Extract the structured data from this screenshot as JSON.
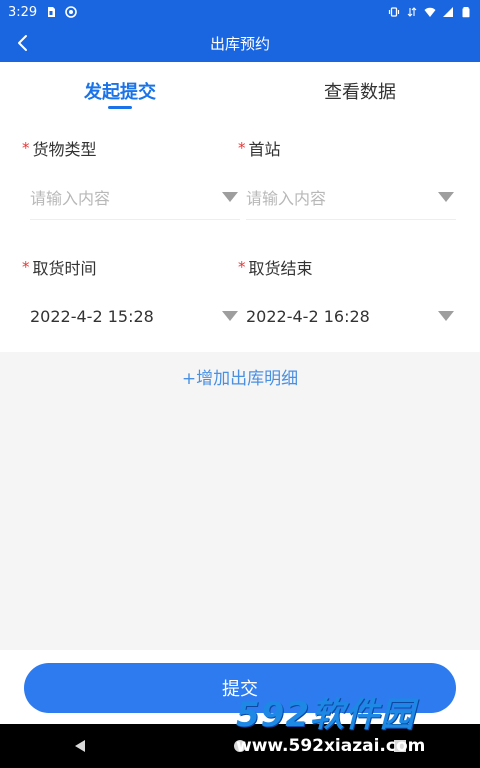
{
  "status_bar": {
    "time": "3:29",
    "left_icons": [
      "sim-card-icon",
      "sync-icon"
    ],
    "right_icons": [
      "vibrate-icon",
      "data-arrows-icon",
      "wifi-icon",
      "signal-icon",
      "battery-icon"
    ]
  },
  "app_bar": {
    "title": "出库预约",
    "back_icon": "chevron-left-icon"
  },
  "tabs": [
    {
      "label": "发起提交",
      "active": true
    },
    {
      "label": "查看数据",
      "active": false
    }
  ],
  "form": {
    "required_mark": "*",
    "fields": [
      {
        "label": "货物类型",
        "value": "",
        "placeholder": "请输入内容"
      },
      {
        "label": "首站",
        "value": "",
        "placeholder": "请输入内容"
      },
      {
        "label": "取货时间",
        "value": "2022-4-2 15:28",
        "placeholder": ""
      },
      {
        "label": "取货结束",
        "value": "2022-4-2 16:28",
        "placeholder": ""
      }
    ],
    "add_detail_label": "+增加出库明细"
  },
  "submit_label": "提交",
  "watermark": {
    "logo": "592软件园",
    "url": "www.592xiazai.com"
  },
  "colors": {
    "primary": "#1a66e0",
    "accent": "#1a73e8",
    "required": "#e53935",
    "button": "#2d7bef"
  }
}
